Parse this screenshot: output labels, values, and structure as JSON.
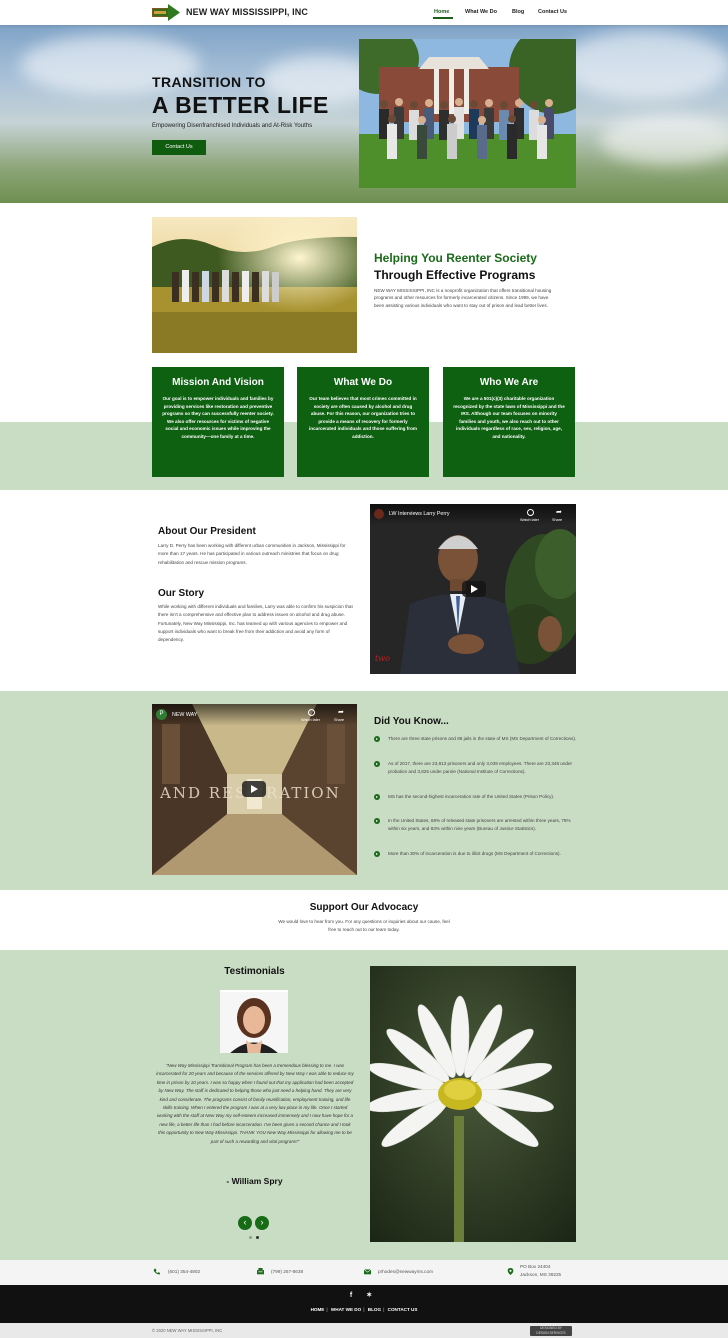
{
  "header": {
    "site_name": "NEW WAY MISSISSIPPI, INC",
    "nav": [
      "Home",
      "What We Do",
      "Blog",
      "Contact Us"
    ]
  },
  "hero": {
    "title_line1": "TRANSITION TO",
    "title_line2": "A BETTER LIFE",
    "subtitle": "Empowering Disenfranchised Individuals and At-Risk Youths",
    "button": "Contact Us"
  },
  "intro": {
    "title_line1": "Helping You Reenter Society",
    "title_line2": "Through Effective Programs",
    "text": "NEW WAY MISSISSIPPI, INC is a nonprofit organization that offers transitional housing programs and other resources for formerly incarcerated citizens. Since 1999, we have been assisting various individuals who want to stay out of prison and lead better lives."
  },
  "cards": [
    {
      "title": "Mission And Vision",
      "text": "Our goal is to empower individuals and families by providing services like restoration and preventive programs so they can successfully reenter society. We also offer resources for victims of negative social and economic issues while improving the community—one family at a time."
    },
    {
      "title": "What We Do",
      "text": "Our team believes that most crimes committed in society are often caused by alcohol and drug abuse. For this reason, our organization tries to provide a means of recovery for formerly incarcerated individuals and those suffering from addiction."
    },
    {
      "title": "Who We Are",
      "text": "We are a 501(c)(3) charitable organization recognized by the state laws of Mississippi and the IRS. Although our team focuses on minority families and youth, we also reach out to other individuals regardless of race, sex, religion, age, and nationality."
    }
  ],
  "president": {
    "heading": "About Our President",
    "text": "Larry D. Perry has been working with different urban communities in Jackson, Mississippi for more than 17 years. He has participated in various outreach ministries that focus on drug rehabilitation and rescue mission programs.",
    "story_heading": "Our Story",
    "story_text": "While working with different individuals and families, Larry was able to confirm his suspicion that there isn't a comprehensive and effective plan to address issues on alcohol and drug abuse. Fortunately, New Way Mississippi, Inc. has teamed up with various agencies to empower and support individuals who want to break free from their addiction and avoid any form of dependency."
  },
  "video1": {
    "channel_initial": "",
    "title": "LW Interviews Larry Perry",
    "watch_later": "Watch later",
    "share": "Share",
    "watermark": "two"
  },
  "video2": {
    "channel_initial": "P",
    "title": "NEW WAY",
    "watch_later": "Watch later",
    "share": "Share",
    "overlay_text": "AND REST RATION"
  },
  "did_you_know": {
    "heading": "Did You Know...",
    "facts": [
      "There are three state prisons and 89 jails in the state of MS (MS Department of Corrections).",
      "As of 2017, there are 23,813 prisoners and only 3,039 employees. There are 23,348 under probation and 3,825 under parole (National Institute of Corrections).",
      "MS has the second-highest incarceration rate of the United States (Prison Policy).",
      "In the United States, 68% of released state prisoners are arrested within three years, 79% within six years, and 83% within nine years (Bureau of Justice Statistics).",
      "More than 30% of incarceration is due to illicit drugs (MS Department of Corrections)."
    ]
  },
  "support": {
    "heading": "Support Our Advocacy",
    "text": "We would love to hear from you. For any questions or inquiries about our cause, feel free to reach out to our team today."
  },
  "testimonials": {
    "heading": "Testimonials",
    "quote": "\"New Way Mississippi Transitional Program has been a tremendous blessing to me. I was incarcerated for 20 years and because of the services offered by New Way I was able to reduce my time in prison by 10 years. I was so happy when I found out that my application had been accepted by New Way. The staff is dedicated to helping those who just need a helping hand. They are very kind and considerate. The programs consist of family reunification, employment training, and life skills training. When I entered the program I was at a very low place in my life. Once I started working with the staff at New Way my self-esteem increased immensely and I now have hope for a new life, a better life than I had before incarceration. I've been given a second chance and I took this opportunity to New Way Mississippi. THANK YOU New Way Mississippi for allowing me to be part of such a rewarding and vital program!!\"",
    "author": "- William Spry",
    "prev": "‹",
    "next": "›"
  },
  "contact": {
    "phone": "(601) 354-4802",
    "fax": "(799) 257-8638",
    "email": "prhodes@newwayms.com",
    "address_line1": "PO Box 24404",
    "address_line2": "Jackson, MS 39225"
  },
  "footer": {
    "social": [
      "f",
      "✶"
    ],
    "nav": [
      "HOME",
      "WHAT WE DO",
      "BLOG",
      "CONTACT US"
    ],
    "copyright": "© 2020 NEW WAY MISSISSIPPI, INC",
    "badge_line1": "DESIGNED BY",
    "badge_line2": "DESIGN SERVICES"
  },
  "colors": {
    "brand_green": "#0f6112",
    "band_green": "#c9dcc4",
    "footer_dark": "#111111"
  }
}
